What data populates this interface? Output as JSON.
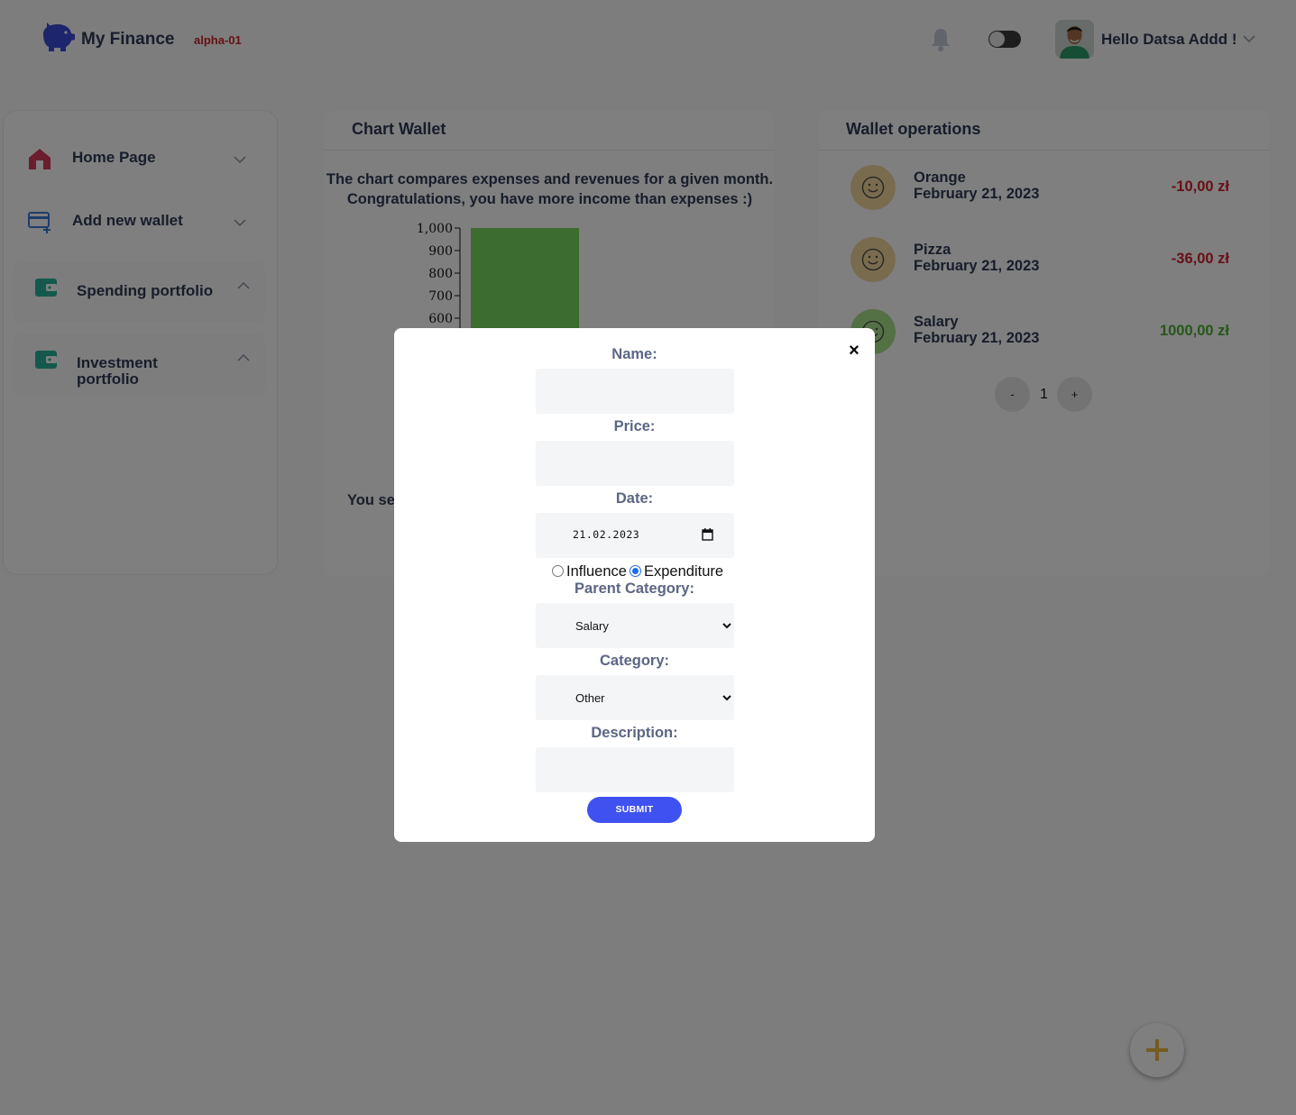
{
  "header": {
    "brand": "My Finance",
    "version": "alpha-01",
    "greeting": "Hello Datsa Addd !"
  },
  "sidebar": {
    "items": [
      {
        "label": "Home Page",
        "icon": "home-icon",
        "expanded": false
      },
      {
        "label": "Add new wallet",
        "icon": "add-wallet-icon",
        "expanded": false
      },
      {
        "label": "Spending portfolio",
        "icon": "wallet-icon",
        "expanded": true
      },
      {
        "label": "Investment portfolio",
        "icon": "wallet-icon",
        "expanded": true
      }
    ]
  },
  "chart_card": {
    "title": "Chart Wallet",
    "description_line1": "The chart compares expenses and revenues for a given month.",
    "description_line2": "Congratulations, you have more income than expenses :)",
    "note_visible": "You se"
  },
  "chart_data": {
    "type": "bar",
    "yticks": [
      "1,000",
      "900",
      "800",
      "700",
      "600"
    ],
    "ylim_visible": [
      600,
      1000
    ],
    "series": [
      {
        "values": [
          1000
        ],
        "color": "#7ad95f"
      }
    ]
  },
  "operations": {
    "title": "Wallet operations",
    "items": [
      {
        "name": "Orange",
        "date": "February 21, 2023",
        "amount": "-10,00 zł",
        "type": "expense"
      },
      {
        "name": "Pizza",
        "date": "February 21, 2023",
        "amount": "-36,00 zł",
        "type": "expense"
      },
      {
        "name": "Salary",
        "date": "February 21, 2023",
        "amount": "1000,00 zł",
        "type": "income"
      }
    ],
    "pager": {
      "prev": "-",
      "page": "1",
      "next": "+"
    }
  },
  "modal": {
    "close": "×",
    "name_label": "Name:",
    "name_value": "",
    "price_label": "Price:",
    "price_value": "",
    "date_label": "Date:",
    "date_value": "21.02.2023",
    "type_options": [
      "Influence",
      "Expenditure"
    ],
    "type_selected": "Expenditure",
    "parent_category_label": "Parent Category:",
    "parent_category_value": "Salary",
    "category_label": "Category:",
    "category_value": "Other",
    "description_label": "Description:",
    "description_value": "",
    "submit_label": "SUBMIT"
  },
  "colors": {
    "brand": "#3b4bd8",
    "expense": "#d0202a",
    "income": "#4caf2f",
    "submit": "#3f51f1",
    "home_icon": "#d63a5a",
    "wallet_icon": "#2bb39a",
    "add_wallet_icon": "#3a7bd5",
    "fab_plus": "#e9b840"
  }
}
